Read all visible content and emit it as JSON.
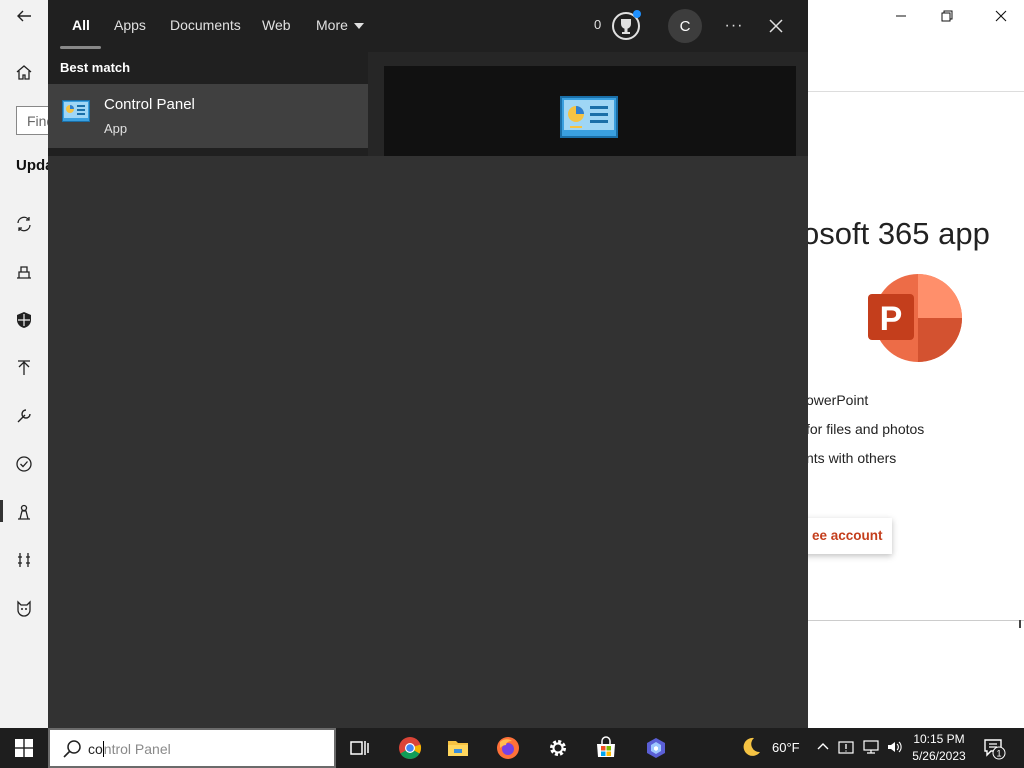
{
  "settings": {
    "find_placeholder": "Find",
    "heading": "Upda"
  },
  "promo": {
    "title": "osoft 365 app",
    "features": [
      "owerPoint",
      "for files and photos",
      "nts with others"
    ],
    "button": "ee account",
    "brand_color": "#c43e1c"
  },
  "search": {
    "tabs": [
      {
        "label": "All",
        "active": true
      },
      {
        "label": "Apps"
      },
      {
        "label": "Documents"
      },
      {
        "label": "Web"
      },
      {
        "label": "More"
      }
    ],
    "rewards_count": "0",
    "avatar_initial": "C",
    "more_options": "···",
    "section_heading": "Best match",
    "result": {
      "title": "Control Panel",
      "subtitle": "App",
      "icon": "control-panel-icon"
    }
  },
  "taskbar": {
    "search_typed": "co",
    "search_hint": "ntrol Panel",
    "apps": [
      "task-view-icon",
      "chrome-icon",
      "file-explorer-icon",
      "firefox-icon",
      "settings-gear-icon",
      "microsoft-store-icon",
      "copilot-icon"
    ],
    "weather_temp": "60°F",
    "time": "10:15 PM",
    "date": "5/26/2023",
    "notification_count": "1"
  },
  "colors": {
    "panel_bg": "#323232",
    "tabs_bg": "#202020",
    "selected_item_bg": "#404040",
    "taskbar_bg": "#1e1e1e"
  }
}
